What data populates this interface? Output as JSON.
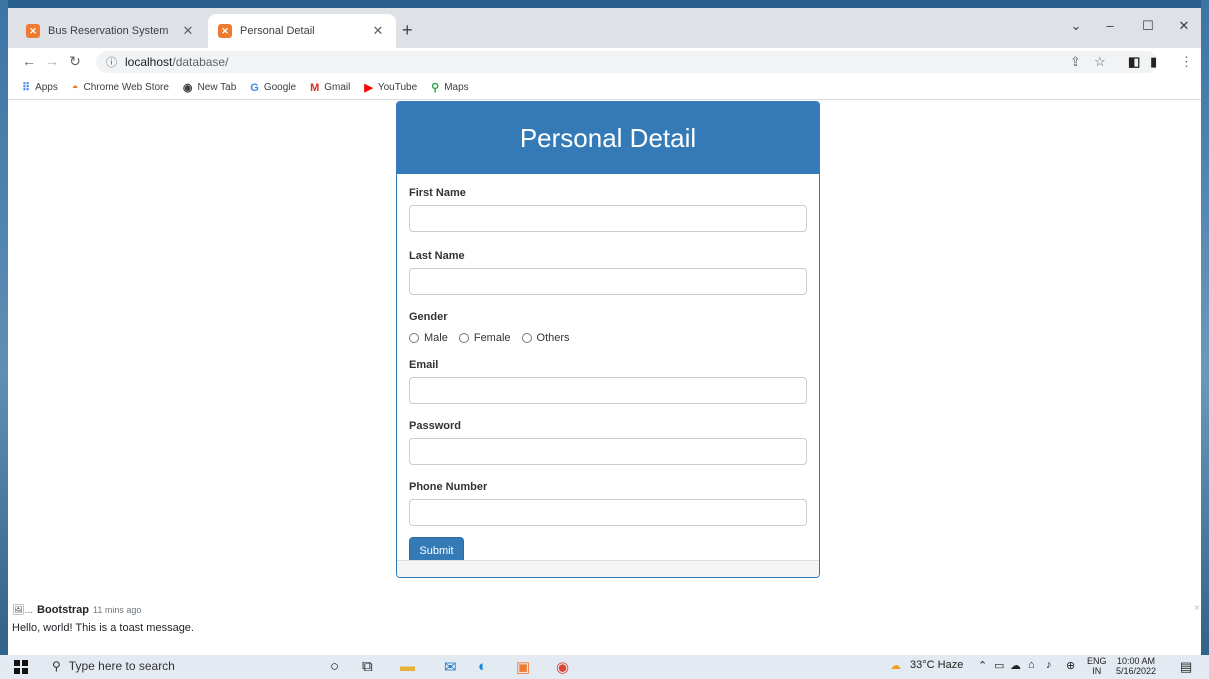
{
  "browser": {
    "tabs": [
      {
        "label": "Bus Reservation System",
        "favicon": "xampp-icon",
        "active": false
      },
      {
        "label": "Personal Detail",
        "favicon": "xampp-icon",
        "active": true
      }
    ],
    "address": {
      "host": "localhost",
      "path": "/database/"
    },
    "bookmarks": [
      {
        "label": "Apps",
        "icon": "apps-grid-icon"
      },
      {
        "label": "Chrome Web Store",
        "icon": "chrome-web-store-icon"
      },
      {
        "label": "New Tab",
        "icon": "new-tab-icon"
      },
      {
        "label": "Google",
        "icon": "google-icon"
      },
      {
        "label": "Gmail",
        "icon": "gmail-icon"
      },
      {
        "label": "YouTube",
        "icon": "youtube-icon"
      },
      {
        "label": "Maps",
        "icon": "maps-icon"
      }
    ]
  },
  "form": {
    "title": "Personal Detail",
    "fields": {
      "first_name": {
        "label": "First Name",
        "value": ""
      },
      "last_name": {
        "label": "Last Name",
        "value": ""
      },
      "email": {
        "label": "Email",
        "value": ""
      },
      "password": {
        "label": "Password",
        "value": ""
      },
      "phone": {
        "label": "Phone Number",
        "value": ""
      }
    },
    "gender": {
      "label": "Gender",
      "options": [
        "Male",
        "Female",
        "Others"
      ]
    },
    "submit_label": "Submit"
  },
  "toast": {
    "img_alt": "...",
    "title": "Bootstrap",
    "time": "11 mins ago",
    "body": "Hello, world! This is a toast message.",
    "close": "×"
  },
  "taskbar": {
    "search_placeholder": "Type here to search",
    "weather": "33°C Haze",
    "lang_top": "ENG",
    "lang_bottom": "IN",
    "time": "10:00 AM",
    "date": "5/16/2022"
  },
  "colors": {
    "primary": "#337ab7",
    "tab_strip": "#dee1e6"
  }
}
